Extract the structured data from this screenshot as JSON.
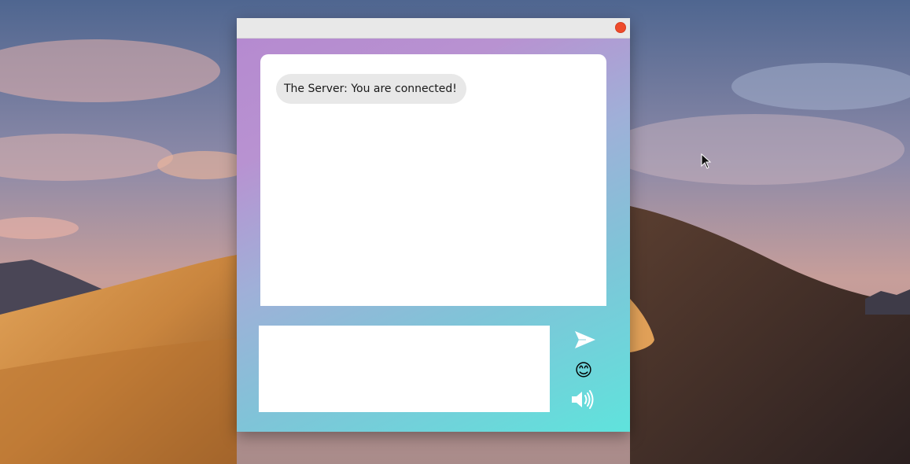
{
  "colors": {
    "titlebar": "#e8e8e8",
    "close_button": "#ee4b2b",
    "gradient_start": "#b58ad0",
    "gradient_end": "#5fe3dc",
    "bubble_background": "#e8e8e8",
    "panel_background": "#ffffff"
  },
  "chat": {
    "messages": [
      {
        "text": "The Server: You are connected!"
      }
    ]
  },
  "composer": {
    "value": "",
    "send_icon": "send-arrow-icon",
    "emoji_icon": "smiley-emoji-icon",
    "emoji_glyph": "😊",
    "sound_icon": "speaker-volume-icon"
  }
}
